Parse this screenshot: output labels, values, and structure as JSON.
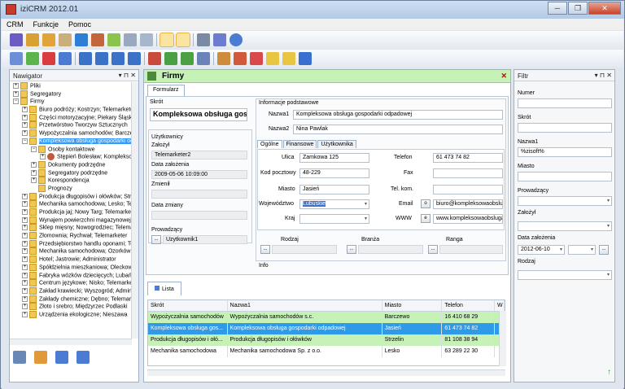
{
  "window": {
    "title": "iziCRM 2012.01",
    "buttons": [
      "─",
      "❐",
      "✕"
    ]
  },
  "menu": [
    "CRM",
    "Funkcje",
    "Pomoc"
  ],
  "navigator": {
    "title": "Nawigator",
    "tree": [
      {
        "label": "Pliki",
        "level": 0,
        "exp": "+"
      },
      {
        "label": "Segregatory",
        "level": 0,
        "exp": "+"
      },
      {
        "label": "Firmy",
        "level": 0,
        "exp": "−"
      },
      {
        "label": "Biuro podróży; Kostrzyn; Telemarketer",
        "level": 1,
        "exp": "+"
      },
      {
        "label": "Części motoryzacyjne; Piekary Śląskie",
        "level": 1,
        "exp": "+"
      },
      {
        "label": "Przetwórstwo Tworzyw Sztucznych",
        "level": 1,
        "exp": "+"
      },
      {
        "label": "Wypożyczalnia samochodów; Barczewo",
        "level": 1,
        "exp": "+"
      },
      {
        "label": "Kompleksowa obsługa gospodarki odpadowej",
        "level": 1,
        "exp": "−",
        "selected": true
      },
      {
        "label": "Osoby kontaktowe",
        "level": 2,
        "exp": "−"
      },
      {
        "label": "Stępień Bolesław; Kompleksowa",
        "level": 3,
        "exp": "+",
        "person": true
      },
      {
        "label": "Dokumenty podrzędne",
        "level": 2,
        "exp": "+"
      },
      {
        "label": "Segregatory podrzędne",
        "level": 2,
        "exp": "+"
      },
      {
        "label": "Korespondencja",
        "level": 2,
        "exp": "+"
      },
      {
        "label": "Prognozy",
        "level": 2,
        "exp": ""
      },
      {
        "label": "Produkcja długopisów i ołówków; Strzelin",
        "level": 1,
        "exp": "+"
      },
      {
        "label": "Mechanika samochodowa; Lesko; Telemarketer",
        "level": 1,
        "exp": "+"
      },
      {
        "label": "Produkcja jaj; Nowy Targ; Telemarketer",
        "level": 1,
        "exp": "+"
      },
      {
        "label": "Wynajem powierzchni magazynowej",
        "level": 1,
        "exp": "+"
      },
      {
        "label": "Sklep mięsny; Nowogrodziec; Telemarketer",
        "level": 1,
        "exp": "+"
      },
      {
        "label": "Złomownia; Rychwał; Telemarketer",
        "level": 1,
        "exp": "+"
      },
      {
        "label": "Przedsiębiorstwo handlu oponami; Tczew",
        "level": 1,
        "exp": "+"
      },
      {
        "label": "Mechanika samochodowa; Ozorków",
        "level": 1,
        "exp": "+"
      },
      {
        "label": "Hotel; Jastrowie; Administrator",
        "level": 1,
        "exp": "+"
      },
      {
        "label": "Spółdzielnia mieszkaniowa; Oleckowo",
        "level": 1,
        "exp": "+"
      },
      {
        "label": "Fabryka wózków dziecięcych; Lubań",
        "level": 1,
        "exp": "+"
      },
      {
        "label": "Centrum językowe; Nisko; Telemarketer",
        "level": 1,
        "exp": "+"
      },
      {
        "label": "Zakład krawiecki; Wyszogród; Administrator",
        "level": 1,
        "exp": "+"
      },
      {
        "label": "Zakłady chemiczne; Dębno; Telemarketer",
        "level": 1,
        "exp": "+"
      },
      {
        "label": "Złoto i srebro; Międzyrzec Podlaski",
        "level": 1,
        "exp": "+"
      },
      {
        "label": "Urządzenia ekologiczne; Nieszawa",
        "level": 1,
        "exp": "+"
      }
    ]
  },
  "firmy": {
    "title": "Firmy",
    "tab": "Formularz",
    "skrot_label": "Skrót",
    "skrot_value": "Kompleksowa obsługa gospodarki",
    "uzytkownicy_label": "Użytkownicy",
    "zalozyl_label": "Założył",
    "zalozyl_value": "Telemarketer2",
    "data_zalozenia_label": "Data założenia",
    "data_zalozenia_value": "2009-05-06 10:09:00",
    "zmienil_label": "Zmienił",
    "data_zmiany_label": "Data zmiany",
    "prowadzacy_label": "Prowadzący",
    "prowadzacy_value": "Uzytkownik1",
    "info_label": "Informacje podstawowe",
    "nazwa1_label": "Nazwa1",
    "nazwa1_value": "Kompleksowa obsługa gospodarki odpadowej",
    "nazwa2_label": "Nazwa2",
    "nazwa2_value": "Nina Pawlak",
    "subtabs": [
      "Ogólne",
      "Finansowe",
      "Użytkownika"
    ],
    "ulica_label": "Ulica",
    "ulica_value": "Zamkowa 125",
    "kod_label": "Kod pocztowy",
    "kod_value": "48-229",
    "miasto_label": "Miasto",
    "miasto_value": "Jasień",
    "woj_label": "Województwo",
    "woj_value": "Lubuskie",
    "kraj_label": "Kraj",
    "telefon_label": "Telefon",
    "telefon_value": "61 473 74 82",
    "fax_label": "Fax",
    "telkom_label": "Tel. kom.",
    "email_label": "Email",
    "email_btn": "o",
    "email_value": "biuro@kompleksowaobsluga",
    "www_label": "WWW",
    "www_btn": "e",
    "www_value": "www.kompleksowaobsluga",
    "rodzaj_label": "Rodzaj",
    "branza_label": "Branża",
    "ranga_label": "Ranga",
    "more_btn": "...",
    "info2_label": "Info"
  },
  "lista": {
    "tab": "Lista",
    "columns": [
      "Skrót",
      "Nazwa1",
      "Miasto",
      "Telefon",
      "W"
    ],
    "rows": [
      {
        "skrot": "Wypożyczalnia samochodów",
        "nazwa": "Wypożyczalnia samochodów s.c.",
        "miasto": "Barczewo",
        "telefon": "16 410 68 29",
        "style": "g"
      },
      {
        "skrot": "Kompleksowa obsługa gos...",
        "nazwa": "Kompleksowa obsługa gospodarki odpadowej",
        "miasto": "Jasień",
        "telefon": "61 473 74 82",
        "style": "s"
      },
      {
        "skrot": "Produkcja długopisów i ołó...",
        "nazwa": "Produkcja długopisów i ołówków",
        "miasto": "Strzelin",
        "telefon": "81 108 38 94",
        "style": "g"
      },
      {
        "skrot": "Mechanika samochodowa",
        "nazwa": "Mechanika samochodowa Sp. z o.o.",
        "miasto": "Lesko",
        "telefon": "63 289 22 30",
        "style": ""
      }
    ]
  },
  "filter": {
    "title": "Filtr",
    "numer_label": "Numer",
    "skrot_label": "Skrót",
    "nazwa1_label": "Nazwa1",
    "nazwa1_value": "%zisoft%",
    "miasto_label": "Miasto",
    "prowadzacy_label": "Prowadzący",
    "zalozyl_label": "Założył",
    "data_label": "Data założenia",
    "data_value": "2012-06-10",
    "rodzaj_label": "Rodzaj"
  }
}
